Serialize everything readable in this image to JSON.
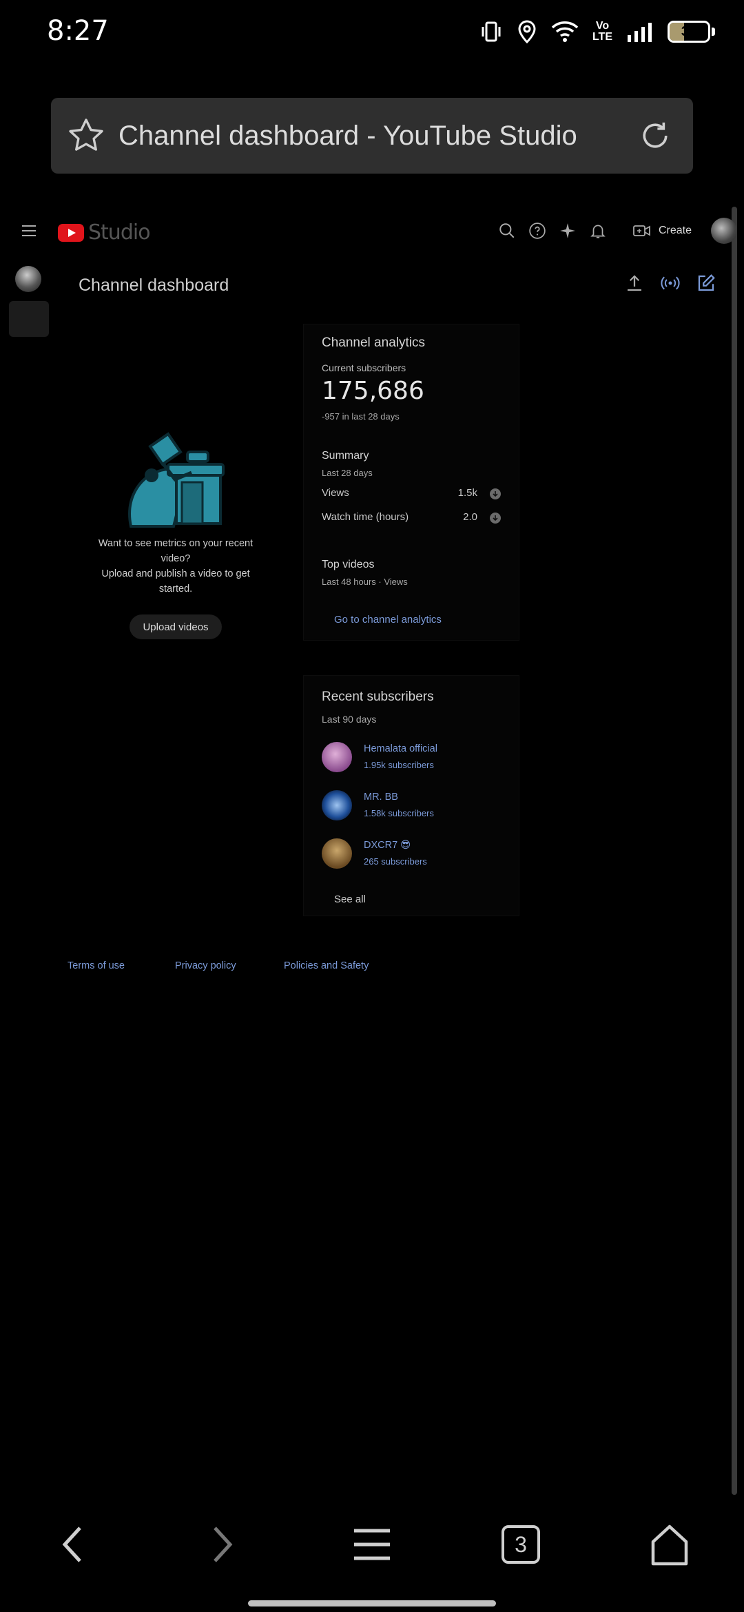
{
  "status": {
    "time": "8:27",
    "volte": [
      "Vo",
      "LTE"
    ],
    "battery": "38",
    "battery_level": 0.38
  },
  "browser": {
    "page_title": "Channel dashboard - YouTube Studio",
    "tab_count": "3"
  },
  "studio": {
    "logo_text": "Studio",
    "create_label": "Create"
  },
  "page": {
    "title": "Channel dashboard"
  },
  "empty_state": {
    "line1": "Want to see metrics on your recent video?",
    "line2": "Upload and publish a video to get started.",
    "button": "Upload videos"
  },
  "analytics": {
    "title": "Channel analytics",
    "current_label": "Current subscribers",
    "subscribers": "175,686",
    "delta": "-957 in last 28 days",
    "summary_title": "Summary",
    "summary_period": "Last 28 days",
    "rows": [
      {
        "label": "Views",
        "value": "1.5k"
      },
      {
        "label": "Watch time (hours)",
        "value": "2.0"
      }
    ],
    "top_title": "Top videos",
    "top_period": "Last 48 hours · Views",
    "link": "Go to channel analytics"
  },
  "recent": {
    "title": "Recent subscribers",
    "period": "Last 90 days",
    "items": [
      {
        "name": "Hemalata official",
        "count": "1.95k subscribers",
        "color": "#b07ab8"
      },
      {
        "name": "MR. BB",
        "count": "1.58k subscribers",
        "color": "#2a5da8"
      },
      {
        "name": "DXCR7 😎",
        "count": "265 subscribers",
        "color": "#8a6a3e"
      }
    ],
    "see_all": "See all"
  },
  "footer": {
    "terms": "Terms of use",
    "privacy": "Privacy policy",
    "policies": "Policies and Safety"
  }
}
